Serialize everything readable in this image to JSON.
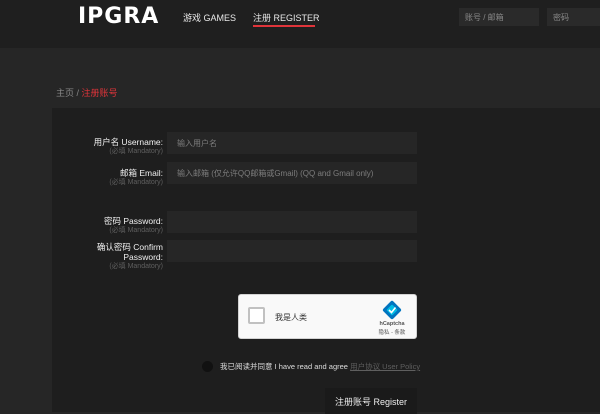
{
  "header": {
    "logo": "IPGRA",
    "nav": [
      {
        "label": "游戏 GAMES",
        "active": false
      },
      {
        "label": "注册 REGISTER",
        "active": true
      }
    ],
    "login": {
      "username_placeholder": "账号 / 邮箱",
      "password_placeholder": "密码"
    }
  },
  "breadcrumb": {
    "home": "主页",
    "separator": " / ",
    "current": "注册账号"
  },
  "form": {
    "username": {
      "label": "用户名 Username:",
      "sublabel": "(必填 Mandatory)",
      "placeholder": "输入用户名"
    },
    "email": {
      "label": "邮箱 Email:",
      "sublabel": "(必填 Mandatory)",
      "placeholder": "输入邮箱 (仅允许QQ邮箱或Gmail) (QQ and Gmail only)"
    },
    "password": {
      "label": "密码 Password:",
      "sublabel": "(必填 Mandatory)"
    },
    "confirm_password": {
      "label_line1": "确认密码 Confirm",
      "label_line2": "Password:",
      "sublabel": "(必填 Mandatory)"
    },
    "captcha": {
      "label": "我是人类",
      "brand": "hCaptcha",
      "links": "隐私 - 条款"
    },
    "agreement": {
      "text": "我已阅读并同意 I have read and agree",
      "link": "用户协议 User Policy"
    },
    "submit": "注册账号 Register"
  },
  "colors": {
    "accent": "#e0343a",
    "background": "#262626",
    "panel": "#1e1e1e",
    "topbar": "#1f1f1f"
  }
}
